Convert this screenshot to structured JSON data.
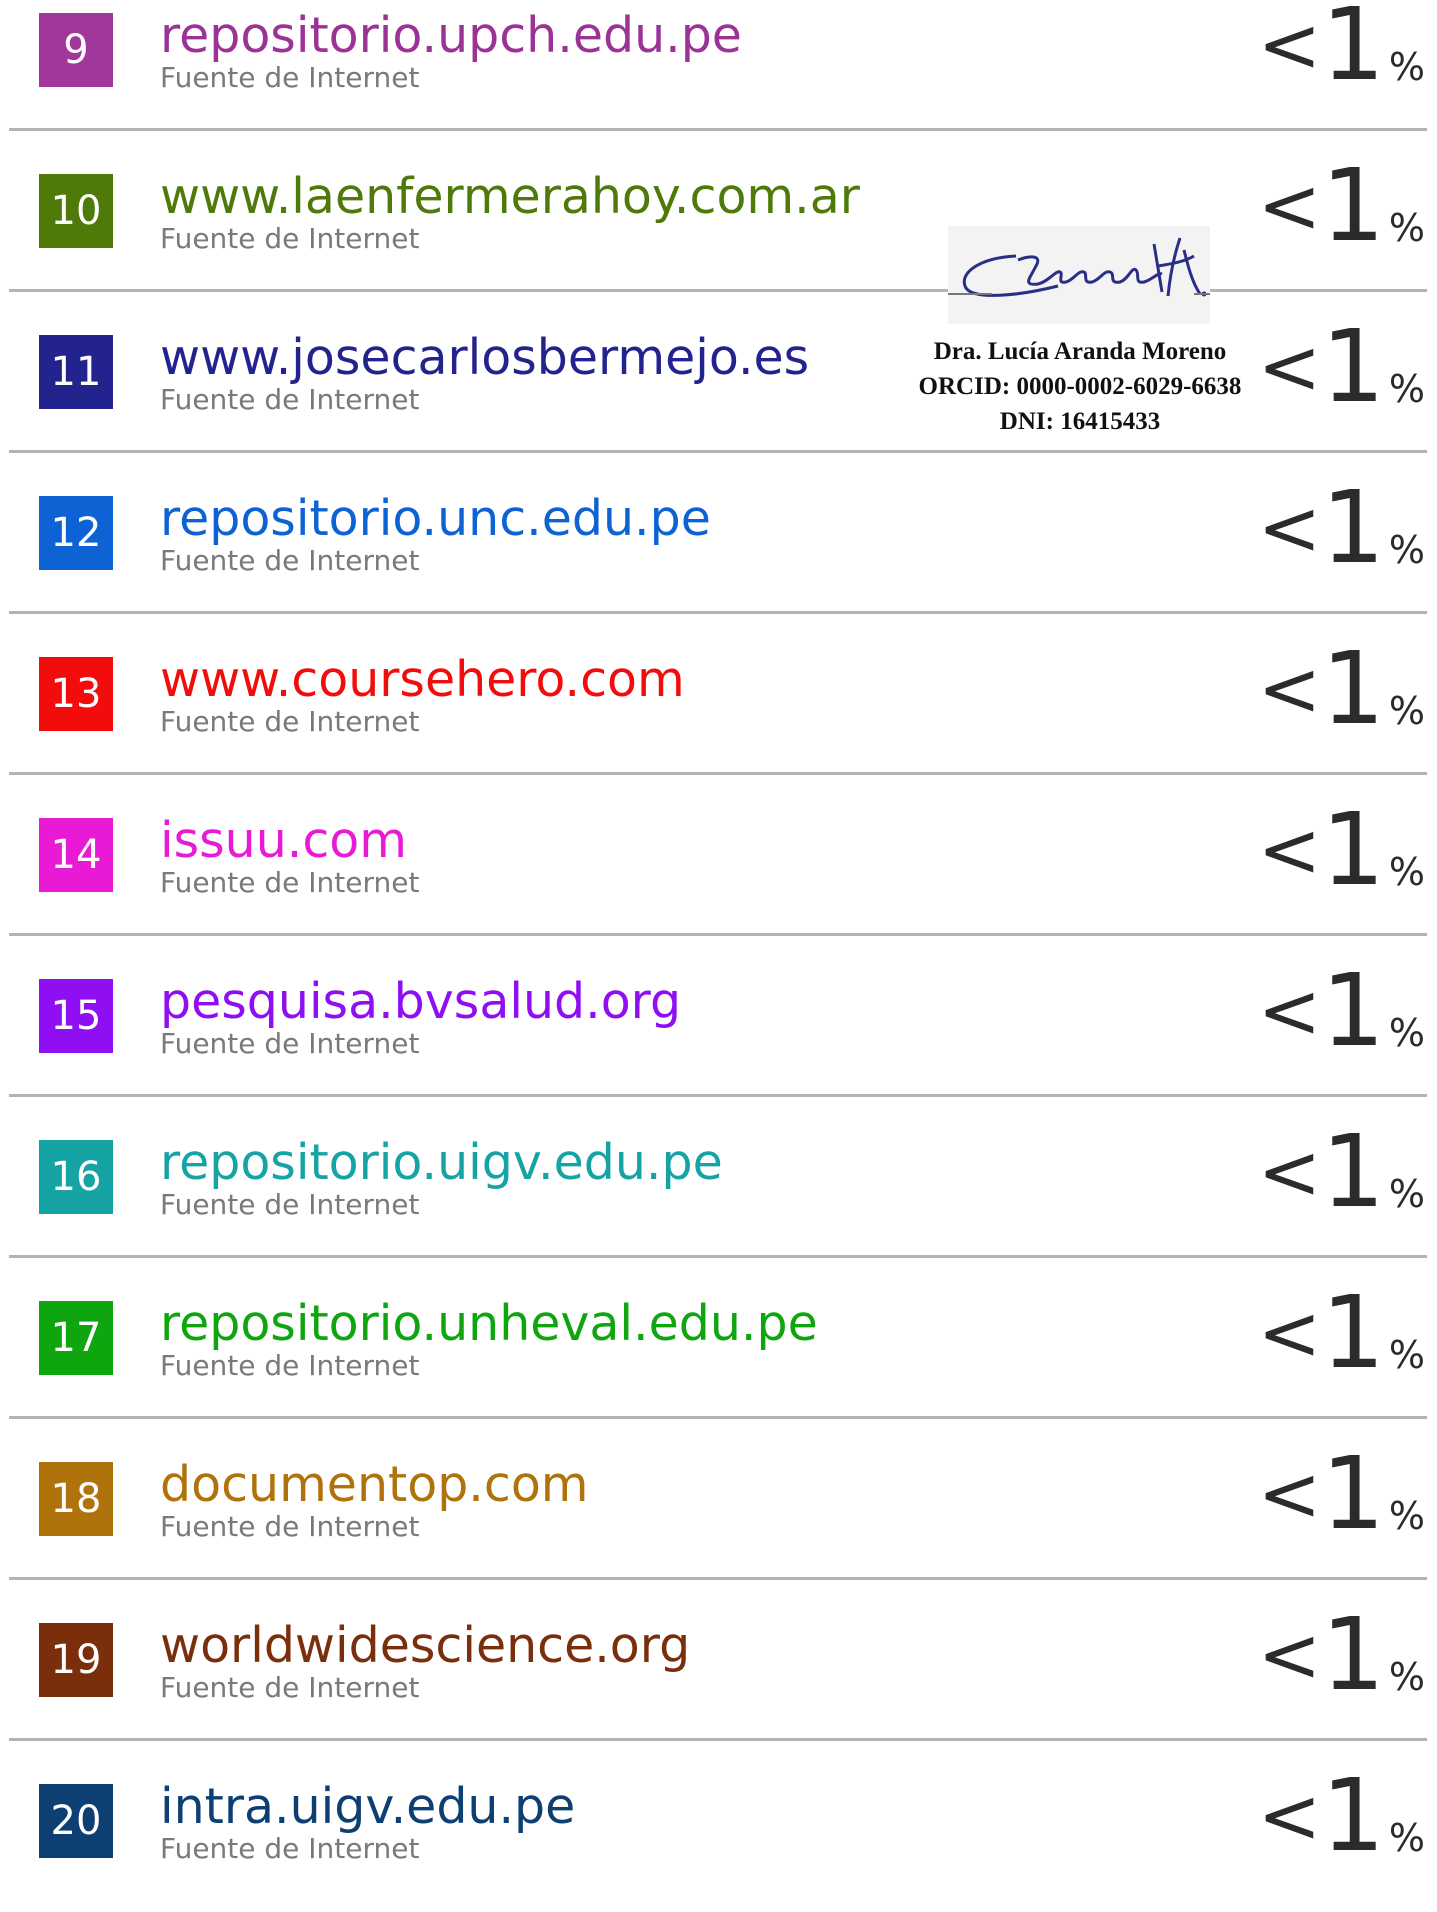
{
  "sources": [
    {
      "number": "9",
      "name": "repositorio.upch.edu.pe",
      "type": "Fuente de Internet",
      "percent": "<1",
      "percent_symbol": "%",
      "badge_color": "#a1379b",
      "text_color": "#9b3397"
    },
    {
      "number": "10",
      "name": "www.laenfermerahoy.com.ar",
      "type": "Fuente de Internet",
      "percent": "<1",
      "percent_symbol": "%",
      "badge_color": "#4f7a0a",
      "text_color": "#4f7a0a"
    },
    {
      "number": "11",
      "name": "www.josecarlosbermejo.es",
      "type": "Fuente de Internet",
      "percent": "<1",
      "percent_symbol": "%",
      "badge_color": "#23238e",
      "text_color": "#23238e"
    },
    {
      "number": "12",
      "name": "repositorio.unc.edu.pe",
      "type": "Fuente de Internet",
      "percent": "<1",
      "percent_symbol": "%",
      "badge_color": "#0e63d4",
      "text_color": "#0e63d4"
    },
    {
      "number": "13",
      "name": "www.coursehero.com",
      "type": "Fuente de Internet",
      "percent": "<1",
      "percent_symbol": "%",
      "badge_color": "#f30c0c",
      "text_color": "#f30c0c"
    },
    {
      "number": "14",
      "name": "issuu.com",
      "type": "Fuente de Internet",
      "percent": "<1",
      "percent_symbol": "%",
      "badge_color": "#e81ad6",
      "text_color": "#e81ad6"
    },
    {
      "number": "15",
      "name": "pesquisa.bvsalud.org",
      "type": "Fuente de Internet",
      "percent": "<1",
      "percent_symbol": "%",
      "badge_color": "#8f0ff2",
      "text_color": "#8f0ff2"
    },
    {
      "number": "16",
      "name": "repositorio.uigv.edu.pe",
      "type": "Fuente de Internet",
      "percent": "<1",
      "percent_symbol": "%",
      "badge_color": "#15a3a3",
      "text_color": "#15a3a3"
    },
    {
      "number": "17",
      "name": "repositorio.unheval.edu.pe",
      "type": "Fuente de Internet",
      "percent": "<1",
      "percent_symbol": "%",
      "badge_color": "#0ea50e",
      "text_color": "#0ea50e"
    },
    {
      "number": "18",
      "name": "documentop.com",
      "type": "Fuente de Internet",
      "percent": "<1",
      "percent_symbol": "%",
      "badge_color": "#b0720a",
      "text_color": "#b0720a"
    },
    {
      "number": "19",
      "name": "worldwidescience.org",
      "type": "Fuente de Internet",
      "percent": "<1",
      "percent_symbol": "%",
      "badge_color": "#7a2e0c",
      "text_color": "#7a2e0c"
    },
    {
      "number": "20",
      "name": "intra.uigv.edu.pe",
      "type": "Fuente de Internet",
      "percent": "<1",
      "percent_symbol": "%",
      "badge_color": "#0d3f73",
      "text_color": "#0d3f73"
    }
  ],
  "signature": {
    "name": "Dra. Lucía Aranda Moreno",
    "orcid": "ORCID: 0000-0002-6029-6638",
    "dni": "DNI: 16415433",
    "handwriting": "Aranda"
  }
}
